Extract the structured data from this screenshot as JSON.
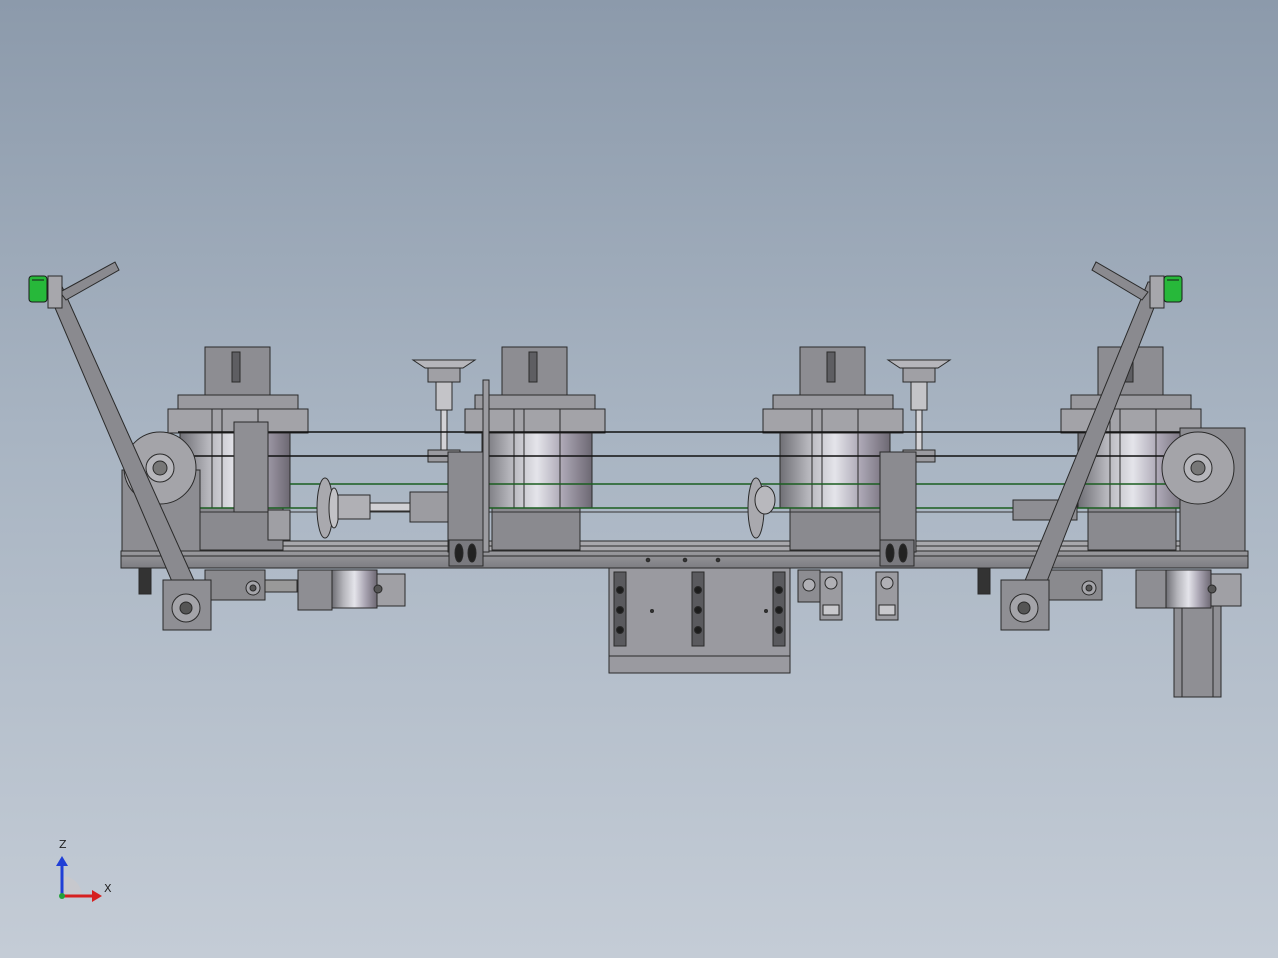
{
  "view": {
    "background_top": "#8c9aab",
    "background_bottom": "#c4ccd6",
    "part_color": "#8e8e92",
    "sensor_color": "#27b83a"
  },
  "triad": {
    "z_label": "Z",
    "x_label": "X",
    "z_color": "#1f3fd6",
    "x_color": "#d62020",
    "origin_color": "#22a03a"
  }
}
